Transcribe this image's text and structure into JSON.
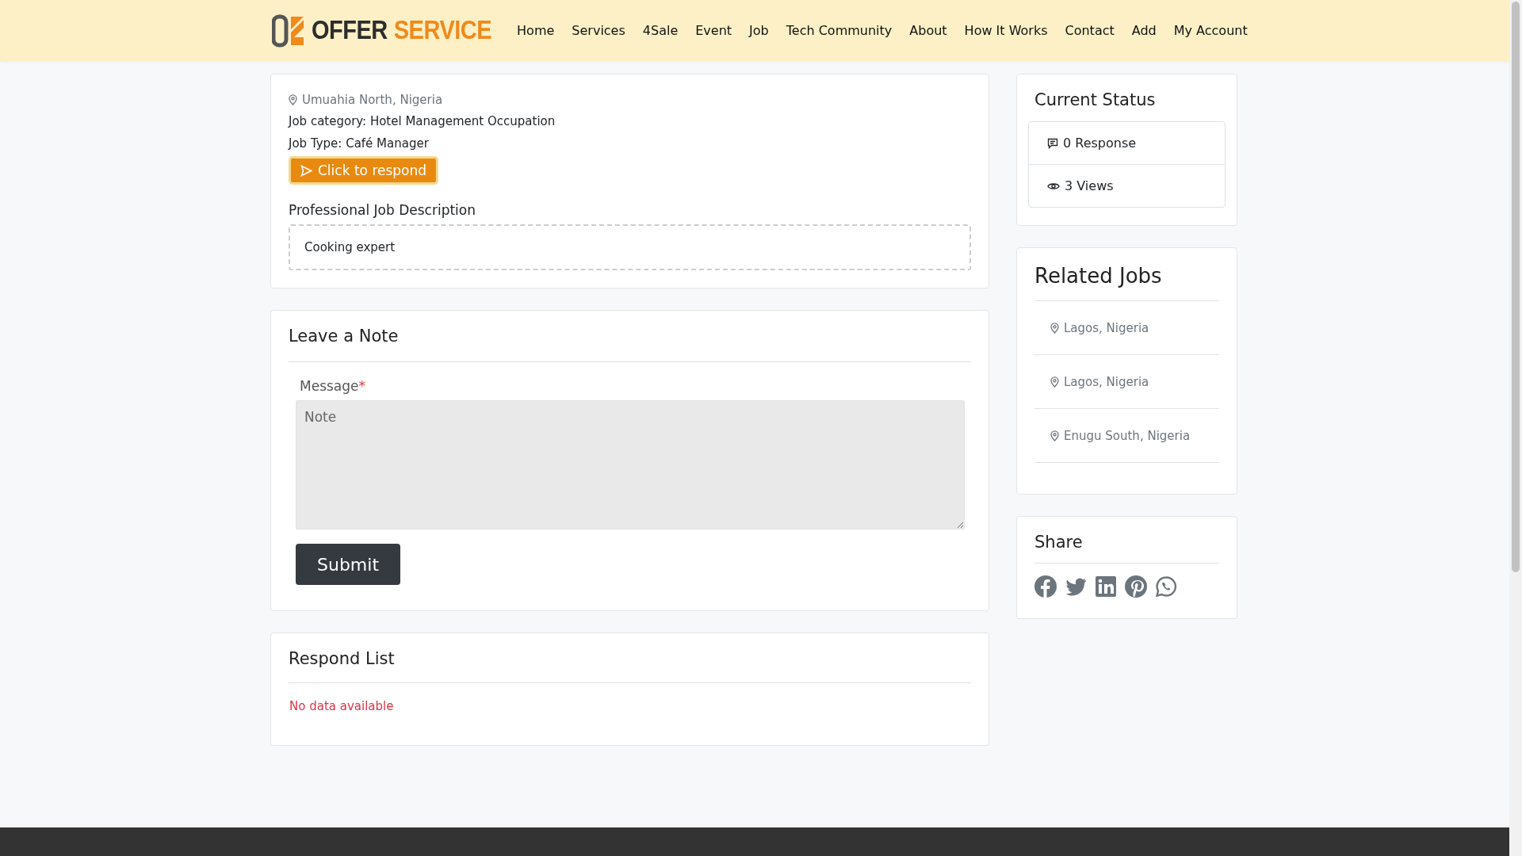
{
  "header": {
    "logo": {
      "word_1": "OFFER",
      "word_2": "SERVICE"
    },
    "nav": [
      "Home",
      "Services",
      "4Sale",
      "Event",
      "Job",
      "Tech Community",
      "About",
      "How It Works",
      "Contact",
      "Add",
      "My Account"
    ]
  },
  "job": {
    "location": "Umuahia North, Nigeria",
    "category": "Job category: Hotel Management Occupation",
    "type": "Job Type: Café Manager",
    "respond_button": "Click to respond",
    "description_title": "Professional Job Description",
    "description": "Cooking expert"
  },
  "note": {
    "title": "Leave a Note",
    "field_label": "Message",
    "required_mark": "*",
    "placeholder": "Note",
    "submit": "Submit"
  },
  "respond_list": {
    "title": "Respond List",
    "empty_message": "No data available"
  },
  "status": {
    "title": "Current Status",
    "items": [
      {
        "kind": "responses",
        "text": "0 Response"
      },
      {
        "kind": "views",
        "text": "3 Views"
      }
    ]
  },
  "related_jobs": {
    "title": "Related Jobs",
    "items": [
      {
        "location": "Lagos, Nigeria"
      },
      {
        "location": "Lagos, Nigeria"
      },
      {
        "location": "Enugu South, Nigeria"
      }
    ]
  },
  "share": {
    "title": "Share"
  }
}
